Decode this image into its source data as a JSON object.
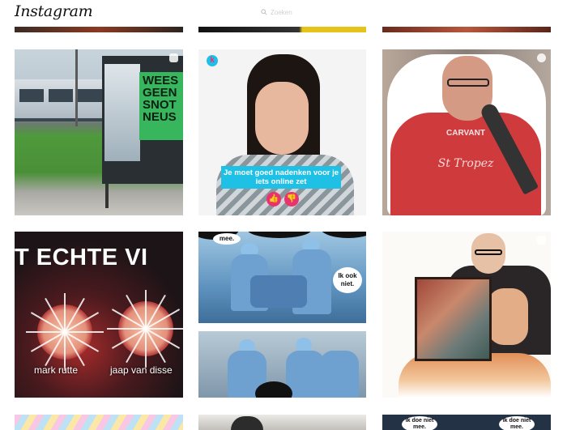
{
  "header": {
    "logo": "Instagram",
    "search": {
      "icon": "search-icon",
      "placeholder": "Zoeken"
    }
  },
  "posts": [
    {
      "id": "post-1",
      "poster_text": [
        "WEES",
        "GEEN",
        "SNOT",
        "NEUS"
      ],
      "corner_icon": "carousel-icon"
    },
    {
      "id": "post-2",
      "brand_icon": "klokhuis-k-icon",
      "caption": "Je moet goed nadenken voor je iets online zet",
      "reaction_icons": [
        "thumbs-up-icon",
        "thumbs-down-icon"
      ]
    },
    {
      "id": "post-3",
      "shirt_text": "St Tropez",
      "shirt_brand": "CARVANT",
      "corner_icon": "video-icon"
    },
    {
      "id": "post-4",
      "title": "T ECHTE VI",
      "labels": [
        "mark rutte",
        "jaap van disse"
      ]
    },
    {
      "id": "post-5",
      "bubbles": [
        "mee.",
        "Ik ook niet."
      ]
    },
    {
      "id": "post-6",
      "corner_icon": "carousel-icon"
    },
    {
      "id": "post-9",
      "bubbles": [
        "Ik doe niet mee.",
        "Ik doe niet mee."
      ]
    }
  ],
  "colors": {
    "caption_bg": "#1ec0e6",
    "reaction_bg": "#e8336d",
    "poster_green": "#37b65e",
    "shirt_red": "#cf3b3d"
  }
}
